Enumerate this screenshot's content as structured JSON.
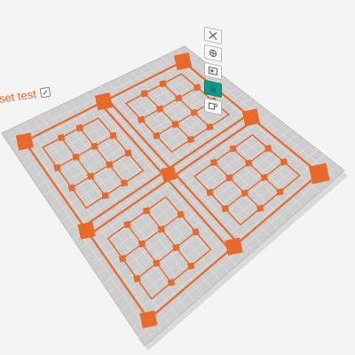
{
  "plate": {
    "label": "set test",
    "edit_icon": "edit-icon",
    "bed_color": "#cdcdcd",
    "grid_color": "#dedede",
    "model_color": "#e8692a"
  },
  "toolbar": {
    "active_color": "#109a8a",
    "buttons": [
      {
        "name": "remove-plate-button",
        "icon": "close-icon",
        "active": false
      },
      {
        "name": "orient-plate-button",
        "icon": "orient-icon",
        "active": false
      },
      {
        "name": "arrange-plate-button",
        "icon": "arrange-icon",
        "active": false
      },
      {
        "name": "lock-plate-button",
        "icon": "lock-icon",
        "active": true
      },
      {
        "name": "plate-settings-button",
        "icon": "settings-icon",
        "active": false
      }
    ]
  }
}
